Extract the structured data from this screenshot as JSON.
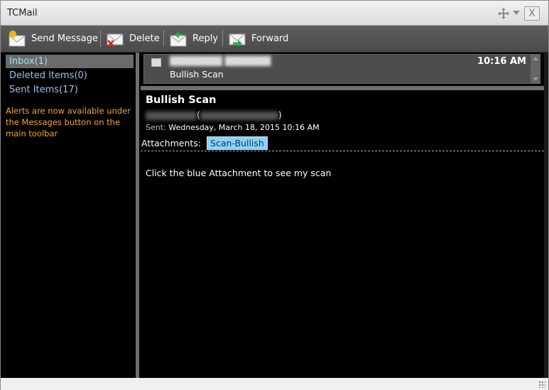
{
  "window": {
    "title": "TCMail"
  },
  "toolbar": {
    "send_label": "Send Message",
    "delete_label": "Delete",
    "reply_label": "Reply",
    "forward_label": "Forward"
  },
  "folders": [
    {
      "label": "Inbox(1)"
    },
    {
      "label": "Deleted Items(0)"
    },
    {
      "label": "Sent Items(17)"
    }
  ],
  "alert_note": "Alerts are now available under the Messages button on the main toolbar",
  "message_list": {
    "time": "10:16 AM",
    "subject": "Bullish Scan"
  },
  "reader": {
    "subject": "Bullish Scan",
    "sent_label": "Sent:",
    "sent_value": "Wednesday, March 18, 2015 10:16 AM",
    "attachments_label": "Attachments:",
    "attachment_name": "Scan-Bullish",
    "body": "Click the blue Attachment to see my scan"
  },
  "colors": {
    "accent_link": "#8ec8ee",
    "alert_text": "#f5a623",
    "attachment_chip": "#8fd2f3"
  }
}
